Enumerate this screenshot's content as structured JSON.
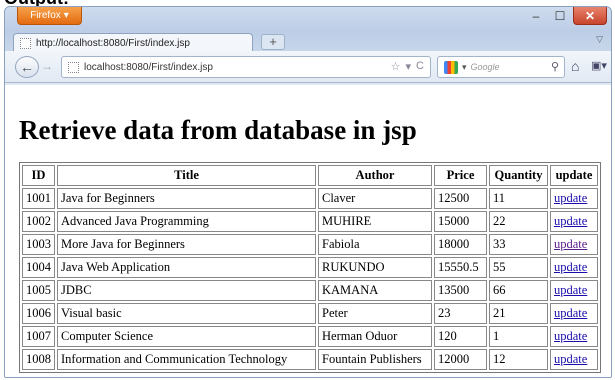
{
  "caption": "Output:",
  "browser": {
    "menu_label": "Firefox",
    "tab_label": "http://localhost:8080/First/index.jsp",
    "url": "localhost:8080/First/index.jsp",
    "search_placeholder": "Google"
  },
  "page": {
    "title": "Retrieve data from database in jsp",
    "columns": [
      "ID",
      "Title",
      "Author",
      "Price",
      "Quantity",
      "update"
    ],
    "rows": [
      {
        "id": "1001",
        "title": "Java for Beginners",
        "author": "Claver",
        "price": "12500",
        "quantity": "11",
        "action": "update"
      },
      {
        "id": "1002",
        "title": "Advanced Java Programming",
        "author": "MUHIRE",
        "price": "15000",
        "quantity": "22",
        "action": "update"
      },
      {
        "id": "1003",
        "title": "More Java for Beginners",
        "author": "Fabiola",
        "price": "18000",
        "quantity": "33",
        "action": "update"
      },
      {
        "id": "1004",
        "title": "Java Web Application",
        "author": "RUKUNDO",
        "price": "15550.5",
        "quantity": "55",
        "action": "update"
      },
      {
        "id": "1005",
        "title": "JDBC",
        "author": "KAMANA",
        "price": "13500",
        "quantity": "66",
        "action": "update"
      },
      {
        "id": "1006",
        "title": "Visual basic",
        "author": "Peter",
        "price": "23",
        "quantity": "21",
        "action": "update"
      },
      {
        "id": "1007",
        "title": "Computer Science",
        "author": "Herman Oduor",
        "price": "120",
        "quantity": "1",
        "action": "update"
      },
      {
        "id": "1008",
        "title": "Information and Communication Technology",
        "author": "Fountain Publishers",
        "price": "12000",
        "quantity": "12",
        "action": "update"
      }
    ]
  },
  "colors": {
    "link": "#1a0dab",
    "visited_link": "#551a8b",
    "firefox_button": "#e46b10",
    "close_button": "#c8442c"
  }
}
